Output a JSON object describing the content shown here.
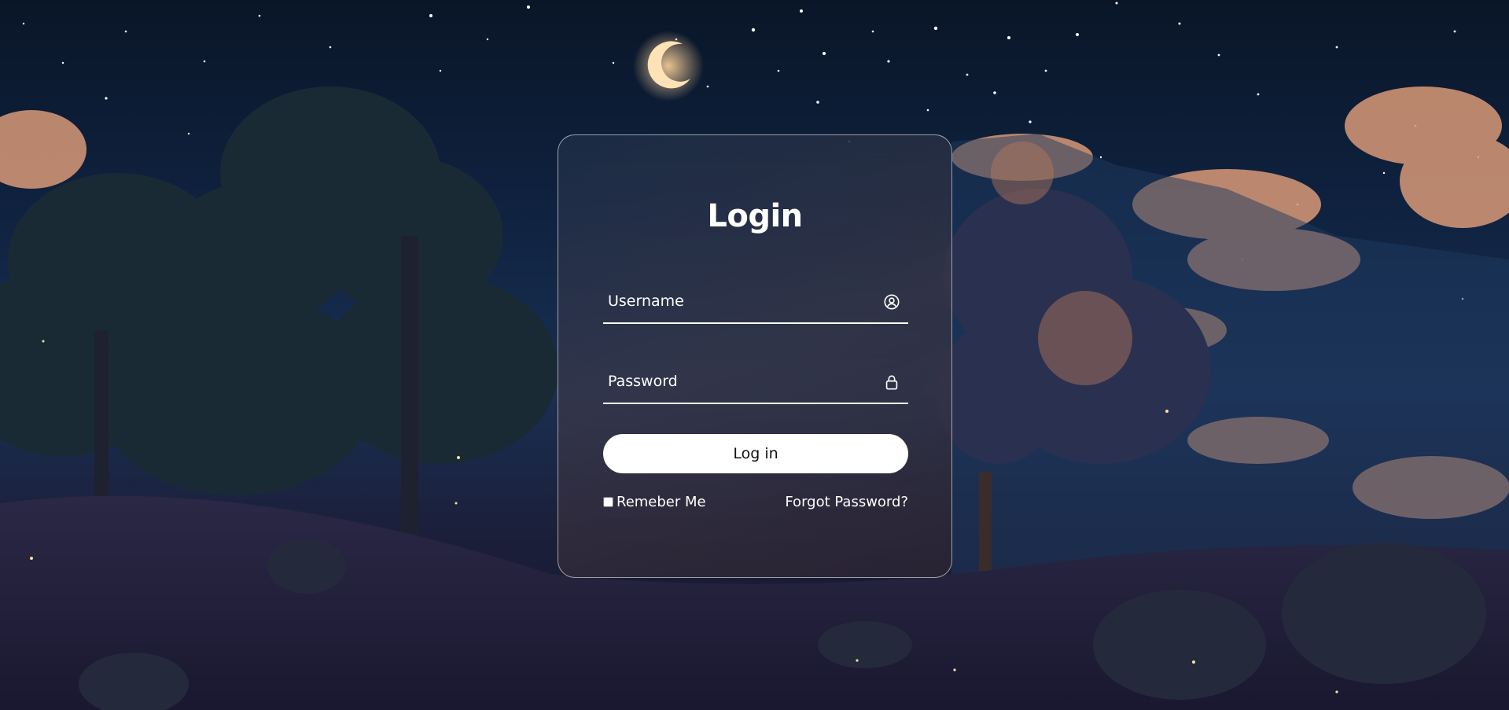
{
  "login": {
    "title": "Login",
    "username_placeholder": "Username",
    "password_placeholder": "Password",
    "login_button": "Log in",
    "remember_label": "Remeber Me",
    "forgot_link": "Forgot Password?"
  },
  "icons": {
    "username": "user-circle-icon",
    "password": "lock-icon"
  },
  "colors": {
    "text": "#ffffff",
    "button_bg": "#ffffff",
    "button_text": "#111111"
  }
}
